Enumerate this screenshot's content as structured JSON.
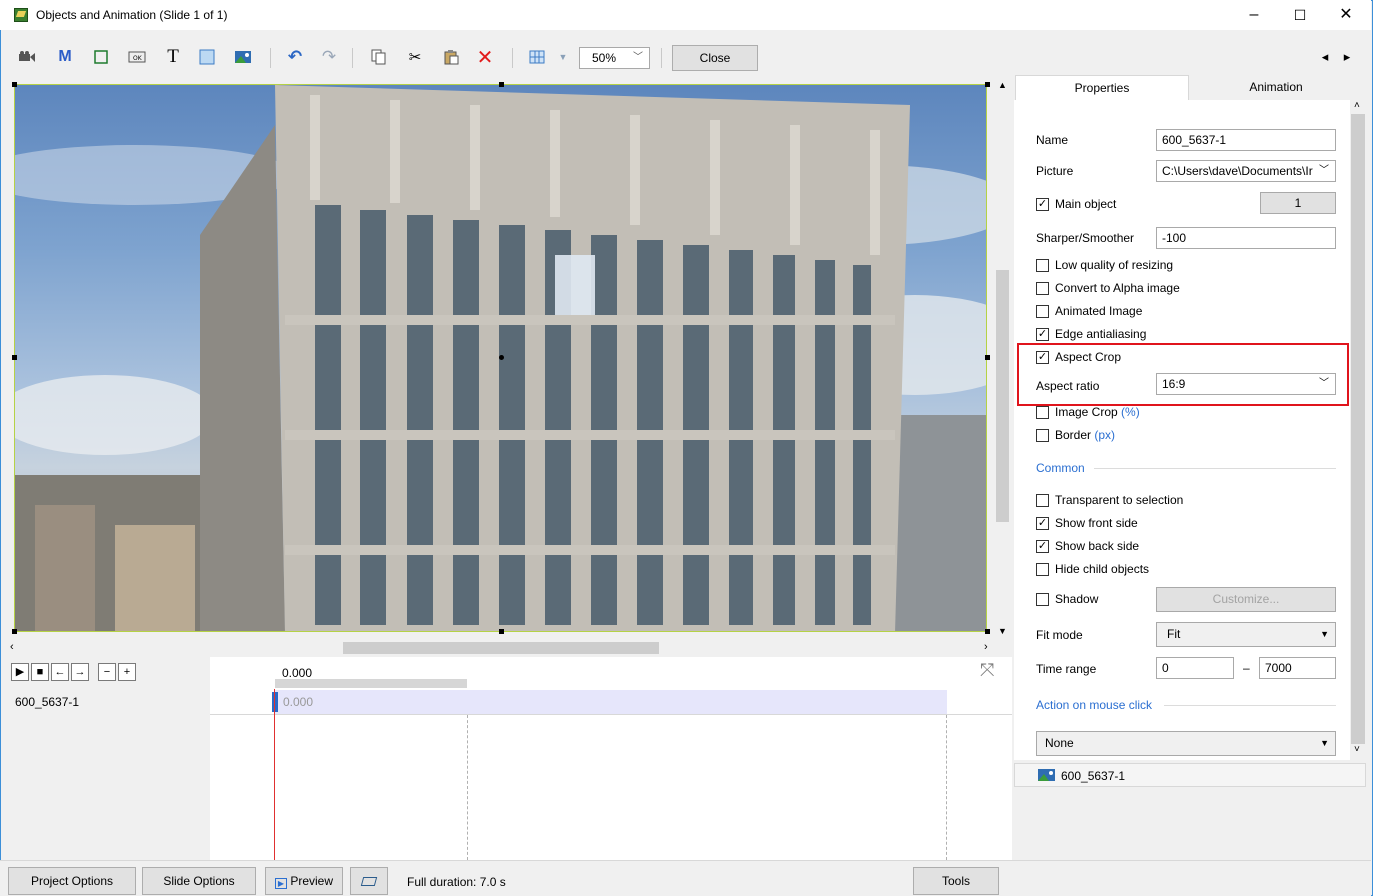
{
  "window": {
    "title": "Objects and Animation (Slide 1 of 1)",
    "minimize": "–",
    "maximize": "☐",
    "close": "✕"
  },
  "toolbar": {
    "zoom_value": "50%",
    "close_label": "Close",
    "nav_prev": "◂",
    "nav_next": "▸"
  },
  "tabs": {
    "properties": "Properties",
    "animation": "Animation"
  },
  "properties": {
    "name_label": "Name",
    "name_value": "600_5637-1",
    "picture_label": "Picture",
    "picture_value": "C:\\Users\\dave\\Documents\\Ir",
    "main_object_label": "Main object",
    "main_object_checked": true,
    "main_object_number": "1",
    "sharper_label": "Sharper/Smoother",
    "sharper_value": "-100",
    "low_quality_label": "Low quality of resizing",
    "convert_alpha_label": "Convert to Alpha image",
    "animated_image_label": "Animated Image",
    "edge_antialiasing_label": "Edge antialiasing",
    "aspect_crop_label": "Aspect Crop",
    "aspect_ratio_label": "Aspect ratio",
    "aspect_ratio_value": "16:9",
    "image_crop_label": "Image Crop",
    "image_crop_unit": "(%)",
    "border_label": "Border",
    "border_unit": "(px)",
    "common_header": "Common",
    "transparent_label": "Transparent to selection",
    "show_front_label": "Show front side",
    "show_back_label": "Show back side",
    "hide_child_label": "Hide child objects",
    "shadow_label": "Shadow",
    "customize_label": "Customize...",
    "fit_mode_label": "Fit mode",
    "fit_mode_value": "Fit",
    "time_range_label": "Time range",
    "time_range_start": "0",
    "time_range_dash": "–",
    "time_range_end": "7000",
    "action_header": "Action on mouse click",
    "action_value": "None"
  },
  "object_list": {
    "item": "600_5637-1"
  },
  "timeline": {
    "time_value": "0.000",
    "row_name": "600_5637-1",
    "row_time": "0.000"
  },
  "statusbar": {
    "project_options": "Project Options",
    "slide_options": "Slide Options",
    "preview": "Preview",
    "full_duration": "Full duration: 7.0 s",
    "tools": "Tools"
  }
}
